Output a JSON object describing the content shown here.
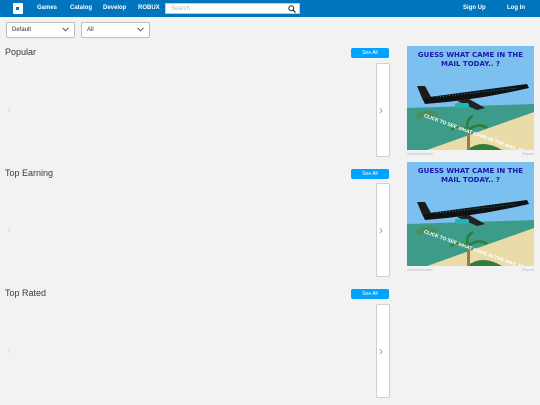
{
  "nav": {
    "logo": "R",
    "links": [
      "Games",
      "Catalog",
      "Develop",
      "ROBUX"
    ],
    "search_placeholder": "Search",
    "signup": "Sign Up",
    "login": "Log In"
  },
  "filters": {
    "sort": "Default",
    "genre": "All"
  },
  "sections": [
    {
      "title": "Popular",
      "see_all": "See All"
    },
    {
      "title": "Top Earning",
      "see_all": "See All"
    },
    {
      "title": "Top Rated",
      "see_all": "See All"
    }
  ],
  "ads": [
    {
      "headline": "GUESS WHAT CAME IN THE MAIL TODAY.. ?",
      "overlay": "CLICK TO SEE WHAT CAME IN THE MAIL TODAY",
      "label": "Advertisement",
      "report": "Report"
    },
    {
      "headline": "GUESS WHAT CAME IN THE MAIL TODAY.. ?",
      "overlay": "CLICK TO SEE WHAT CAME IN THE MAIL TODAY",
      "label": "Advertisement",
      "report": "Report"
    }
  ],
  "icons": {
    "search": "search-icon",
    "chevron": "chevron-down-icon",
    "arrow_left": "chevron-left-icon",
    "arrow_right": "chevron-right-icon"
  },
  "colors": {
    "topbar": "#0074bd",
    "see_all_button": "#00a2ff",
    "background": "#f2f2f2"
  }
}
